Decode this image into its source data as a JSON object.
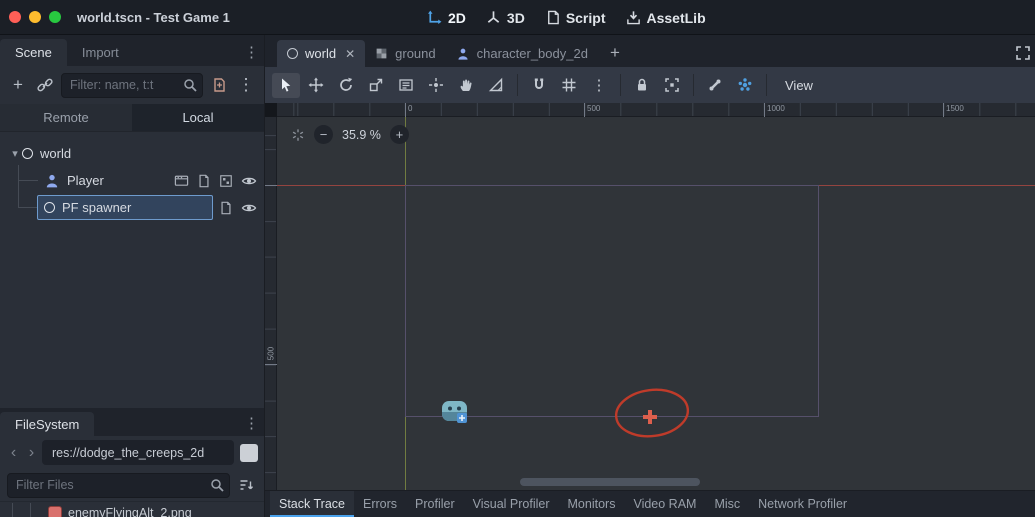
{
  "colors": {
    "accent": "#4aa2ec",
    "selection": "#3e6292",
    "axis_x_red": "#a04641",
    "axis_y_green": "#7d8a43",
    "annotation_red": "#c03a29",
    "titlebar_bg": "#1b1f26",
    "panel_bg": "#2a2f38"
  },
  "icons": {
    "add": "+",
    "close": "✕",
    "menu_dots": "⋮",
    "caret_down": "▾",
    "chevron_left": "‹",
    "chevron_right": "›",
    "minus": "−",
    "plus": "+"
  },
  "titlebar": {
    "title": "world.tscn - Test Game 1",
    "workspaces": [
      {
        "label": "2D",
        "active": true
      },
      {
        "label": "3D",
        "active": false
      },
      {
        "label": "Script",
        "active": false
      },
      {
        "label": "AssetLib",
        "active": false
      }
    ]
  },
  "scene_dock": {
    "tabs": [
      {
        "label": "Scene",
        "active": true
      },
      {
        "label": "Import",
        "active": false
      }
    ],
    "filter_placeholder": "Filter: name, t:t",
    "view_buttons": [
      {
        "label": "Remote",
        "active": false
      },
      {
        "label": "Local",
        "active": true
      }
    ],
    "tree": [
      {
        "label": "world",
        "type": "node",
        "expanded": true,
        "depth": 0
      },
      {
        "label": "Player",
        "type": "character-body-2d",
        "depth": 1
      },
      {
        "label": "PF spawner",
        "type": "node",
        "depth": 1,
        "selected": true
      }
    ]
  },
  "filesystem": {
    "tab": "FileSystem",
    "path": "res://dodge_the_creeps_2d",
    "filter_placeholder": "Filter Files",
    "files": [
      {
        "name": "enemyFlyingAlt_2.png"
      }
    ]
  },
  "workspace": {
    "scene_tabs": [
      {
        "label": "world",
        "active": true,
        "closable": true
      },
      {
        "label": "ground",
        "active": false
      },
      {
        "label": "character_body_2d",
        "active": false
      }
    ],
    "view_menu": "View"
  },
  "viewport": {
    "zoom": "35.9 %",
    "ruler_top": [
      {
        "value": "0"
      },
      {
        "value": "500"
      },
      {
        "value": "1000"
      },
      {
        "value": "1500"
      }
    ],
    "ruler_left": [
      {
        "value": "500"
      }
    ]
  },
  "bottom_panel": {
    "tabs": [
      {
        "label": "Stack Trace",
        "active": true
      },
      {
        "label": "Errors",
        "active": false
      },
      {
        "label": "Profiler",
        "active": false
      },
      {
        "label": "Visual Profiler",
        "active": false
      },
      {
        "label": "Monitors",
        "active": false
      },
      {
        "label": "Video RAM",
        "active": false
      },
      {
        "label": "Misc",
        "active": false
      },
      {
        "label": "Network Profiler",
        "active": false
      }
    ]
  }
}
